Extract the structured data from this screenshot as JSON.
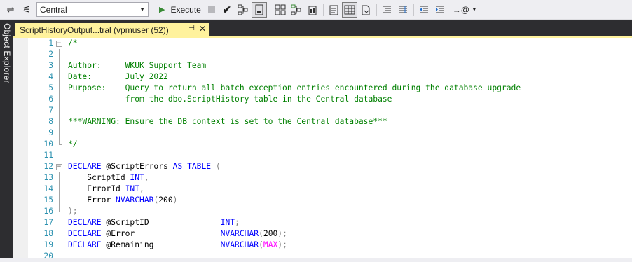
{
  "toolbar": {
    "database": "Central",
    "execute_label": "Execute"
  },
  "sidebar": {
    "object_explorer_label": "Object Explorer"
  },
  "tab": {
    "title": "ScriptHistoryOutput...tral (vpmuser (52))",
    "pin_icon": "pin-icon",
    "close_icon": "close-icon"
  },
  "editor": {
    "lines": [
      {
        "n": "1",
        "parts": [
          {
            "t": "/*",
            "c": "c-green"
          }
        ]
      },
      {
        "n": "2",
        "parts": []
      },
      {
        "n": "3",
        "parts": [
          {
            "t": "Author:     WKUK Support Team",
            "c": "c-green"
          }
        ]
      },
      {
        "n": "4",
        "parts": [
          {
            "t": "Date:       July 2022",
            "c": "c-green"
          }
        ]
      },
      {
        "n": "5",
        "parts": [
          {
            "t": "Purpose:    Query to return all batch exception entries encountered during the database upgrade",
            "c": "c-green"
          }
        ]
      },
      {
        "n": "6",
        "parts": [
          {
            "t": "            from the dbo.ScriptHistory table in the Central database",
            "c": "c-green"
          }
        ]
      },
      {
        "n": "7",
        "parts": []
      },
      {
        "n": "8",
        "parts": [
          {
            "t": "***WARNING: Ensure the DB context is set to the Central database***",
            "c": "c-green"
          }
        ]
      },
      {
        "n": "9",
        "parts": []
      },
      {
        "n": "10",
        "parts": [
          {
            "t": "*/",
            "c": "c-green"
          }
        ]
      },
      {
        "n": "11",
        "parts": []
      },
      {
        "n": "12",
        "parts": [
          {
            "t": "DECLARE",
            "c": "c-blue"
          },
          {
            "t": " @ScriptErrors ",
            "c": "c-black"
          },
          {
            "t": "AS",
            "c": "c-blue"
          },
          {
            "t": " ",
            "c": "c-black"
          },
          {
            "t": "TABLE",
            "c": "c-blue"
          },
          {
            "t": " (",
            "c": "c-gray"
          }
        ]
      },
      {
        "n": "13",
        "parts": [
          {
            "t": "    ScriptId ",
            "c": "c-black"
          },
          {
            "t": "INT",
            "c": "c-blue"
          },
          {
            "t": ",",
            "c": "c-gray"
          }
        ]
      },
      {
        "n": "14",
        "parts": [
          {
            "t": "    ErrorId ",
            "c": "c-black"
          },
          {
            "t": "INT",
            "c": "c-blue"
          },
          {
            "t": ",",
            "c": "c-gray"
          }
        ]
      },
      {
        "n": "15",
        "parts": [
          {
            "t": "    Error ",
            "c": "c-black"
          },
          {
            "t": "NVARCHAR",
            "c": "c-blue"
          },
          {
            "t": "(",
            "c": "c-gray"
          },
          {
            "t": "200",
            "c": "c-black"
          },
          {
            "t": ")",
            "c": "c-gray"
          }
        ]
      },
      {
        "n": "16",
        "parts": [
          {
            "t": ");",
            "c": "c-gray"
          }
        ]
      },
      {
        "n": "17",
        "parts": [
          {
            "t": "DECLARE",
            "c": "c-blue"
          },
          {
            "t": " @ScriptID               ",
            "c": "c-black"
          },
          {
            "t": "INT",
            "c": "c-blue"
          },
          {
            "t": ";",
            "c": "c-gray"
          }
        ]
      },
      {
        "n": "18",
        "parts": [
          {
            "t": "DECLARE",
            "c": "c-blue"
          },
          {
            "t": " @Error                  ",
            "c": "c-black"
          },
          {
            "t": "NVARCHAR",
            "c": "c-blue"
          },
          {
            "t": "(",
            "c": "c-gray"
          },
          {
            "t": "200",
            "c": "c-black"
          },
          {
            "t": ");",
            "c": "c-gray"
          }
        ]
      },
      {
        "n": "19",
        "parts": [
          {
            "t": "DECLARE",
            "c": "c-blue"
          },
          {
            "t": " @Remaining              ",
            "c": "c-black"
          },
          {
            "t": "NVARCHAR",
            "c": "c-blue"
          },
          {
            "t": "(",
            "c": "c-gray"
          },
          {
            "t": "MAX",
            "c": "c-pink"
          },
          {
            "t": ");",
            "c": "c-gray"
          }
        ]
      },
      {
        "n": "20",
        "parts": []
      }
    ]
  },
  "colors": {
    "tab_accent": "#fff29d",
    "dark_chrome": "#2d2d30",
    "line_number": "#2b91af",
    "comment": "#008000",
    "keyword": "#0000ff",
    "function_max": "#ff00ff"
  }
}
